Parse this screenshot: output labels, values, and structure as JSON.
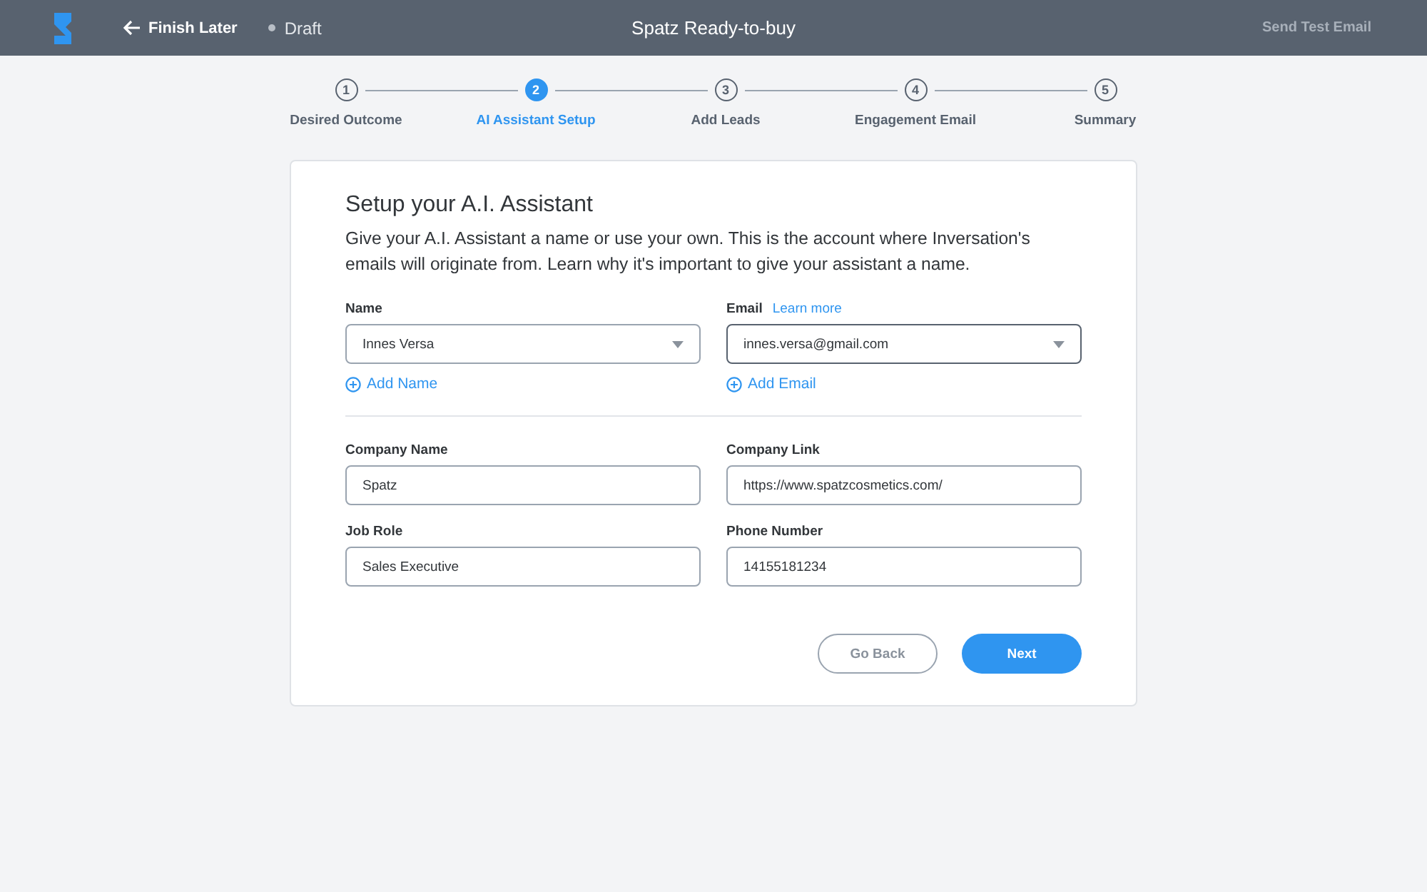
{
  "header": {
    "back_label": "Finish Later",
    "status": "Draft",
    "title": "Spatz Ready-to-buy",
    "action": "Send Test Email"
  },
  "steps": [
    {
      "number": "1",
      "label": "Desired Outcome",
      "selected": false
    },
    {
      "number": "2",
      "label": "AI Assistant Setup",
      "selected": true
    },
    {
      "number": "3",
      "label": "Add Leads",
      "selected": false
    },
    {
      "number": "4",
      "label": "Engagement Email",
      "selected": false
    },
    {
      "number": "5",
      "label": "Summary",
      "selected": false
    }
  ],
  "card": {
    "title": "Setup your A.I. Assistant",
    "description": "Give your A.I. Assistant a name or use your own. This is the account where Inversation's emails will originate from. Learn why it's important to give your assistant a name.",
    "selects": [
      {
        "label": "Name",
        "value": "Innes Versa",
        "focused": false,
        "add": "Add Name"
      },
      {
        "label": "Email",
        "link": "Learn more",
        "value": "innes.versa@gmail.com",
        "focused": true,
        "add": "Add Email"
      }
    ],
    "fields": [
      {
        "label": "Company Name",
        "value": "Spatz"
      },
      {
        "label": "Company Link",
        "value": "https://www.spatzcosmetics.com/"
      },
      {
        "label": "Job Role",
        "value": "Sales Executive"
      },
      {
        "label": "Phone Number",
        "value": "14155181234"
      }
    ],
    "back_button": "Go Back",
    "next_button": "Next"
  }
}
